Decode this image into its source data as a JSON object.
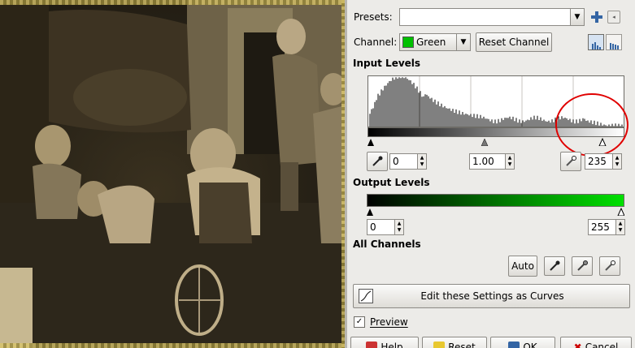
{
  "presets": {
    "label": "Presets:",
    "value": ""
  },
  "channel": {
    "label": "Channel:",
    "value": "Green",
    "reset_label": "Reset Channel"
  },
  "input_levels": {
    "title": "Input Levels",
    "low": "0",
    "gamma": "1.00",
    "high": "235"
  },
  "output_levels": {
    "title": "Output Levels",
    "low": "0",
    "high": "255"
  },
  "all_channels": {
    "title": "All Channels",
    "auto_label": "Auto"
  },
  "curves_button_label": "Edit these Settings as Curves",
  "preview": {
    "label": "Preview",
    "checked": true
  },
  "bottom_buttons": [
    "Help",
    "Reset",
    "OK",
    "Cancel"
  ],
  "colors": {
    "channel_green": "#00e000",
    "annotation_red": "#e00000",
    "accent_blue": "#3465a4"
  }
}
